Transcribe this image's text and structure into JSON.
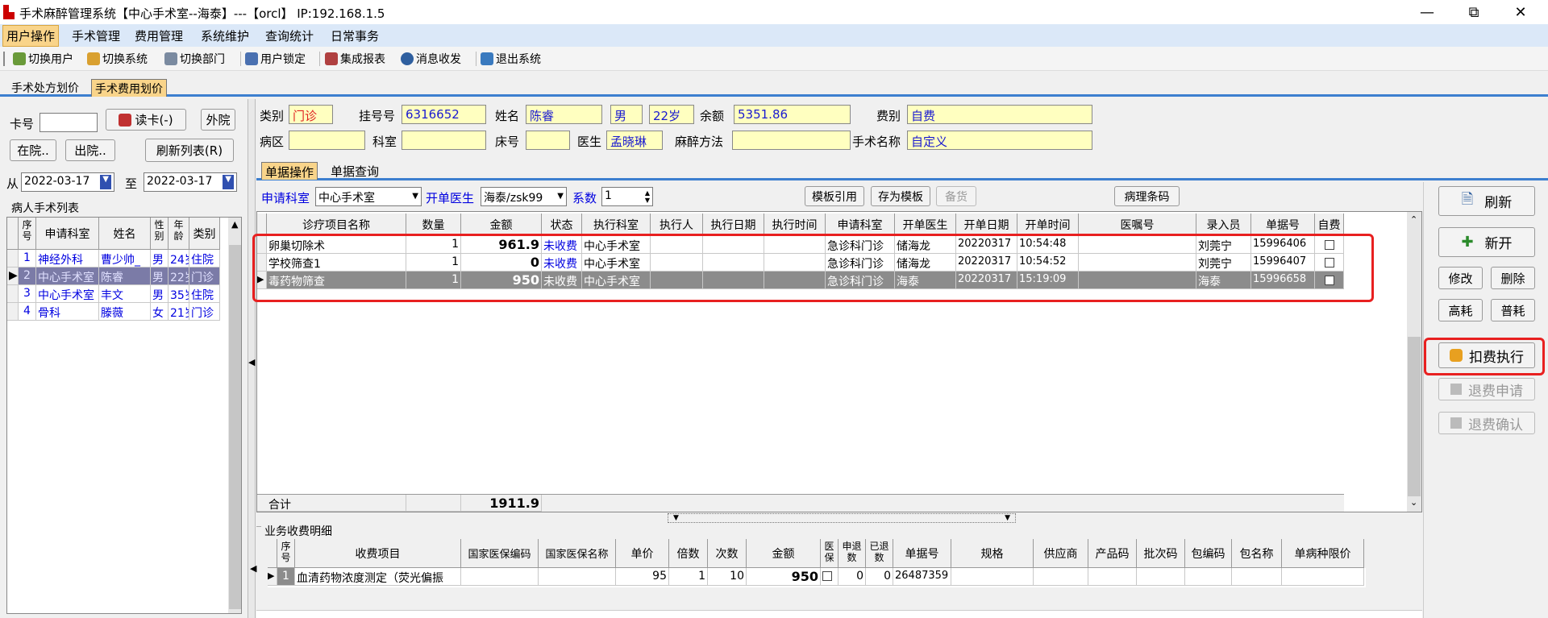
{
  "title": "手术麻醉管理系统【中心手术室--海泰】---【orcl】 IP:192.168.1.5",
  "menu": [
    "用户操作",
    "手术管理",
    "费用管理",
    "系统维护",
    "查询统计",
    "日常事务"
  ],
  "toolbar": [
    "切换用户",
    "切换系统",
    "切换部门",
    "用户锁定",
    "集成报表",
    "消息收发",
    "退出系统"
  ],
  "tabs": [
    "手术处方划价",
    "手术费用划价"
  ],
  "left": {
    "card_label": "卡号",
    "read_card": "读卡(-)",
    "outpatient": "外院",
    "in_hospital": "在院..",
    "discharged": "出院..",
    "refresh_list": "刷新列表(R)",
    "from_label": "从",
    "to_label": "至",
    "date_from": "2022-03-17",
    "date_to": "2022-03-17",
    "list_title": "病人手术列表",
    "headers": [
      "序号",
      "申请科室",
      "姓名",
      "性别",
      "年龄",
      "类别"
    ],
    "rows": [
      [
        "1",
        "神经外科",
        "曹少帅_",
        "男",
        "24岁",
        "住院"
      ],
      [
        "2",
        "中心手术室",
        "陈睿",
        "男",
        "22岁",
        "门诊"
      ],
      [
        "3",
        "中心手术室",
        "丰文",
        "男",
        "35岁",
        "住院"
      ],
      [
        "4",
        "骨科",
        "滕薇",
        "女",
        "21岁",
        "门诊"
      ]
    ]
  },
  "form": {
    "type_label": "类别",
    "type_value": "门诊",
    "reg_label": "挂号号",
    "reg_value": "6316652",
    "name_label": "姓名",
    "name_value": "陈睿",
    "sex_value": "男",
    "age_value": "22岁",
    "balance_label": "余额",
    "balance_value": "5351.86",
    "fee_label": "费别",
    "fee_value": "自费",
    "ward_label": "病区",
    "dept_label": "科室",
    "bed_label": "床号",
    "doctor_label": "医生",
    "doctor_value": "孟晓琳",
    "anes_label": "麻醉方法",
    "surgery_label": "手术名称",
    "surgery_value": "自定义"
  },
  "subtabs": [
    "单据操作",
    "单据查询"
  ],
  "opts": {
    "apply_dept_label": "申请科室",
    "apply_dept_value": "中心手术室",
    "doctor_label": "开单医生",
    "doctor_value": "海泰/zsk99",
    "coef_label": "系数",
    "coef_value": "1",
    "template_use": "模板引用",
    "save_template": "存为模板",
    "stock": "备货",
    "patho": "病理条码"
  },
  "main_grid": {
    "headers": [
      "诊疗项目名称",
      "数量",
      "金额",
      "状态",
      "执行科室",
      "执行人",
      "执行日期",
      "执行时间",
      "申请科室",
      "开单医生",
      "开单日期",
      "开单时间",
      "医嘱号",
      "录入员",
      "单据号",
      "自费"
    ],
    "rows": [
      [
        "卵巢切除术",
        "1",
        "961.9",
        "未收费",
        "中心手术室",
        "",
        "",
        "",
        "急诊科门诊",
        "储海龙",
        "20220317",
        "10:54:48",
        "",
        "刘莞宁",
        "15996406",
        ""
      ],
      [
        "学校筛查1",
        "1",
        "0",
        "未收费",
        "中心手术室",
        "",
        "",
        "",
        "急诊科门诊",
        "储海龙",
        "20220317",
        "10:54:52",
        "",
        "刘莞宁",
        "15996407",
        ""
      ],
      [
        "毒药物筛查",
        "1",
        "950",
        "未收费",
        "中心手术室",
        "",
        "",
        "",
        "急诊科门诊",
        "海泰",
        "20220317",
        "15:19:09",
        "",
        "海泰",
        "15996658",
        ""
      ]
    ],
    "total_label": "合计",
    "total_value": "1911.9"
  },
  "detail": {
    "title": "业务收费明细",
    "headers": [
      "序号",
      "收费项目",
      "国家医保编码",
      "国家医保名称",
      "单价",
      "倍数",
      "次数",
      "金额",
      "医保",
      "申退数",
      "已退数",
      "单据号",
      "规格",
      "供应商",
      "产品码",
      "批次码",
      "包编码",
      "包名称",
      "单病种限价"
    ],
    "rows": [
      [
        "1",
        "血清药物浓度测定（荧光偏振",
        "",
        "",
        "95",
        "1",
        "10",
        "950",
        "",
        "0",
        "0",
        "26487359",
        "",
        "",
        "",
        "",
        "",
        "",
        ""
      ]
    ]
  },
  "right": {
    "refresh": "刷新",
    "new": "新开",
    "modify": "修改",
    "delete": "删除",
    "high": "高耗",
    "normal": "普耗",
    "charge_exec": "扣费执行",
    "refund_apply": "退费申请",
    "refund_confirm": "退费确认"
  },
  "colors": {
    "accent": "#3c7fcf",
    "highlight": "#e82020",
    "selected": "#7b7ba7",
    "yellow": "#ffffc0"
  }
}
